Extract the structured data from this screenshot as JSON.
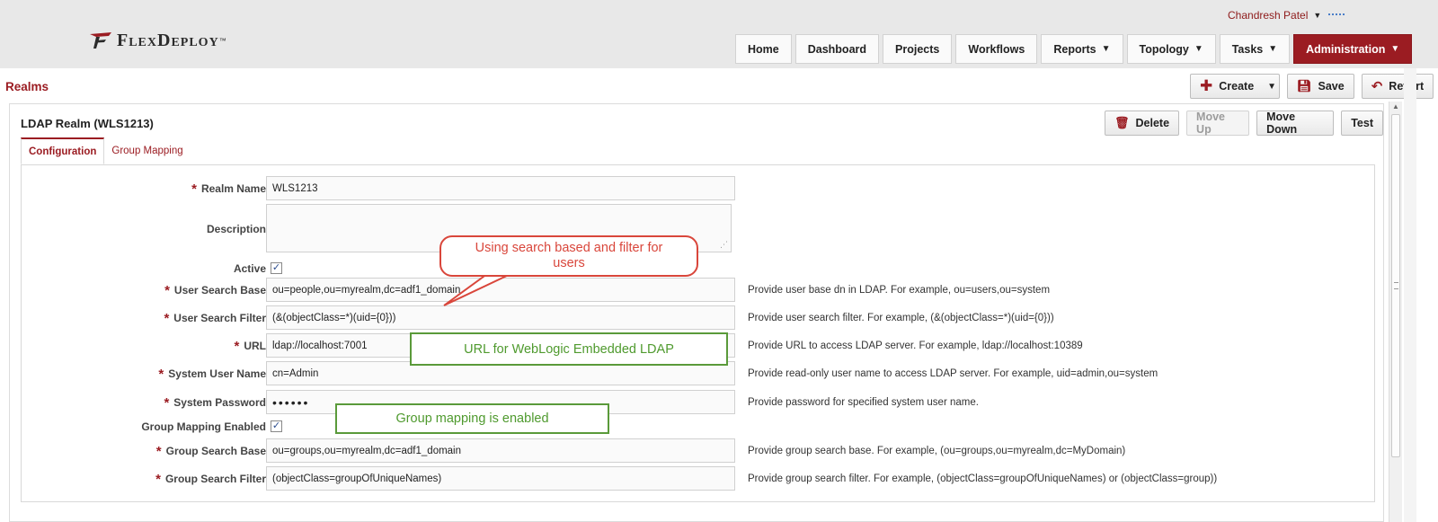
{
  "header": {
    "brand": "FlexDeploy",
    "brand_tm": "™",
    "user_name": "Chandresh Patel",
    "nav": [
      {
        "label": "Home",
        "has_menu": false
      },
      {
        "label": "Dashboard",
        "has_menu": false
      },
      {
        "label": "Projects",
        "has_menu": false
      },
      {
        "label": "Workflows",
        "has_menu": false
      },
      {
        "label": "Reports",
        "has_menu": true
      },
      {
        "label": "Topology",
        "has_menu": true
      },
      {
        "label": "Tasks",
        "has_menu": true
      },
      {
        "label": "Administration",
        "has_menu": true,
        "active": true
      }
    ]
  },
  "page": {
    "title": "Realms",
    "actions": {
      "create": "Create",
      "save": "Save",
      "revert": "Revert"
    }
  },
  "realm": {
    "title": "LDAP Realm (WLS1213)",
    "actions": {
      "delete": "Delete",
      "move_up": "Move Up",
      "move_down": "Move Down",
      "test": "Test"
    },
    "tabs": {
      "configuration": "Configuration",
      "group_mapping": "Group Mapping"
    }
  },
  "form": {
    "realm_name": {
      "label": "Realm Name",
      "value": "WLS1213"
    },
    "description": {
      "label": "Description",
      "value": ""
    },
    "active": {
      "label": "Active",
      "checked": true
    },
    "user_search_base": {
      "label": "User Search Base",
      "value": "ou=people,ou=myrealm,dc=adf1_domain",
      "help": "Provide user base dn in LDAP. For example, ou=users,ou=system"
    },
    "user_search_filter": {
      "label": "User Search Filter",
      "value": "(&(objectClass=*)(uid={0}))",
      "help": "Provide user search filter. For example, (&(objectClass=*)(uid={0}))"
    },
    "url": {
      "label": "URL",
      "value": "ldap://localhost:7001",
      "help": "Provide URL to access LDAP server. For example, ldap://localhost:10389"
    },
    "system_user_name": {
      "label": "System User Name",
      "value": "cn=Admin",
      "help": "Provide read-only user name to access LDAP server. For example, uid=admin,ou=system"
    },
    "system_password": {
      "label": "System Password",
      "value": "••••••",
      "help": "Provide password for specified system user name."
    },
    "group_mapping_enabled": {
      "label": "Group Mapping Enabled",
      "checked": true
    },
    "group_search_base": {
      "label": "Group Search Base",
      "value": "ou=groups,ou=myrealm,dc=adf1_domain",
      "help": "Provide group search base. For example, (ou=groups,ou=myrealm,dc=MyDomain)"
    },
    "group_search_filter": {
      "label": "Group Search Filter",
      "value": "(objectClass=groupOfUniqueNames)",
      "help": "Provide group search filter. For example, (objectClass=groupOfUniqueNames) or (objectClass=group))"
    }
  },
  "annotations": {
    "search": "Using search based and filter for users",
    "url": "URL for WebLogic Embedded LDAP",
    "group": "Group mapping is enabled"
  },
  "colors": {
    "brand_red": "#9b1c22",
    "callout_red": "#d9463b",
    "callout_green": "#5a9a3a"
  }
}
